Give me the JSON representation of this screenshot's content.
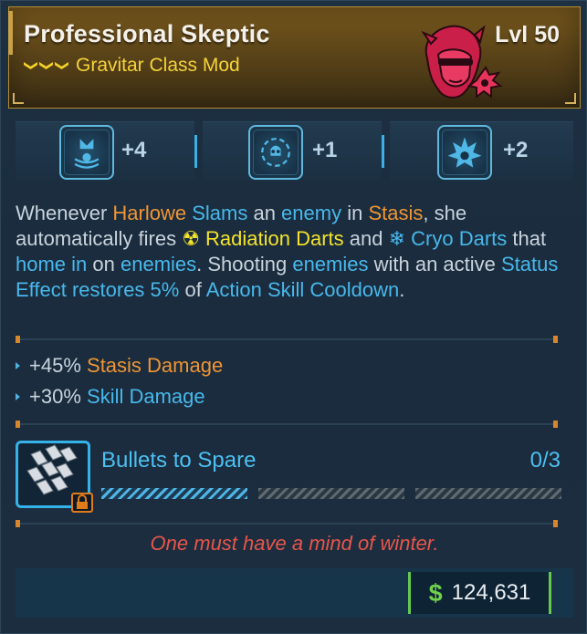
{
  "item": {
    "name": "Professional Skeptic",
    "type": "Gravitar Class Mod",
    "level": "Lvl 50",
    "rarity_color": "#f2d028"
  },
  "skills": [
    {
      "icon": "skill-icon-1",
      "bonus": "+4"
    },
    {
      "icon": "skill-icon-2",
      "bonus": "+1"
    },
    {
      "icon": "skill-icon-3",
      "bonus": "+2"
    }
  ],
  "description": {
    "t1": "Whenever ",
    "k1": "Harlowe",
    "t2": " ",
    "k2": "Slams",
    "t3": " an ",
    "k3": "enemy",
    "t4": " in ",
    "k4": "Stasis",
    "t5": ", she automatically fires ",
    "k5": "Radiation Darts",
    "t6": " and ",
    "k6": "Cryo Darts",
    "t7": " that ",
    "k7": "home in",
    "t8": " on ",
    "k8": "enemies",
    "t9": ". Shooting ",
    "k9": "enemies",
    "t10": " with an active ",
    "k10": "Status Effect restores 5%",
    "t11": " of ",
    "k11": "Action Skill Cooldown",
    "t12": "."
  },
  "stats": [
    {
      "value": "+45%",
      "label": "Stasis Damage",
      "color": "#f09534"
    },
    {
      "value": "+30%",
      "label": "Skill Damage",
      "color": "#48b8ec"
    }
  ],
  "augment": {
    "title": "Bullets to Spare",
    "count": "0/3",
    "progress_segments_filled": 1,
    "progress_segments_total": 3
  },
  "flavor_text": "One must have a mind of winter.",
  "price": {
    "currency_symbol": "$",
    "value": "124,631"
  }
}
